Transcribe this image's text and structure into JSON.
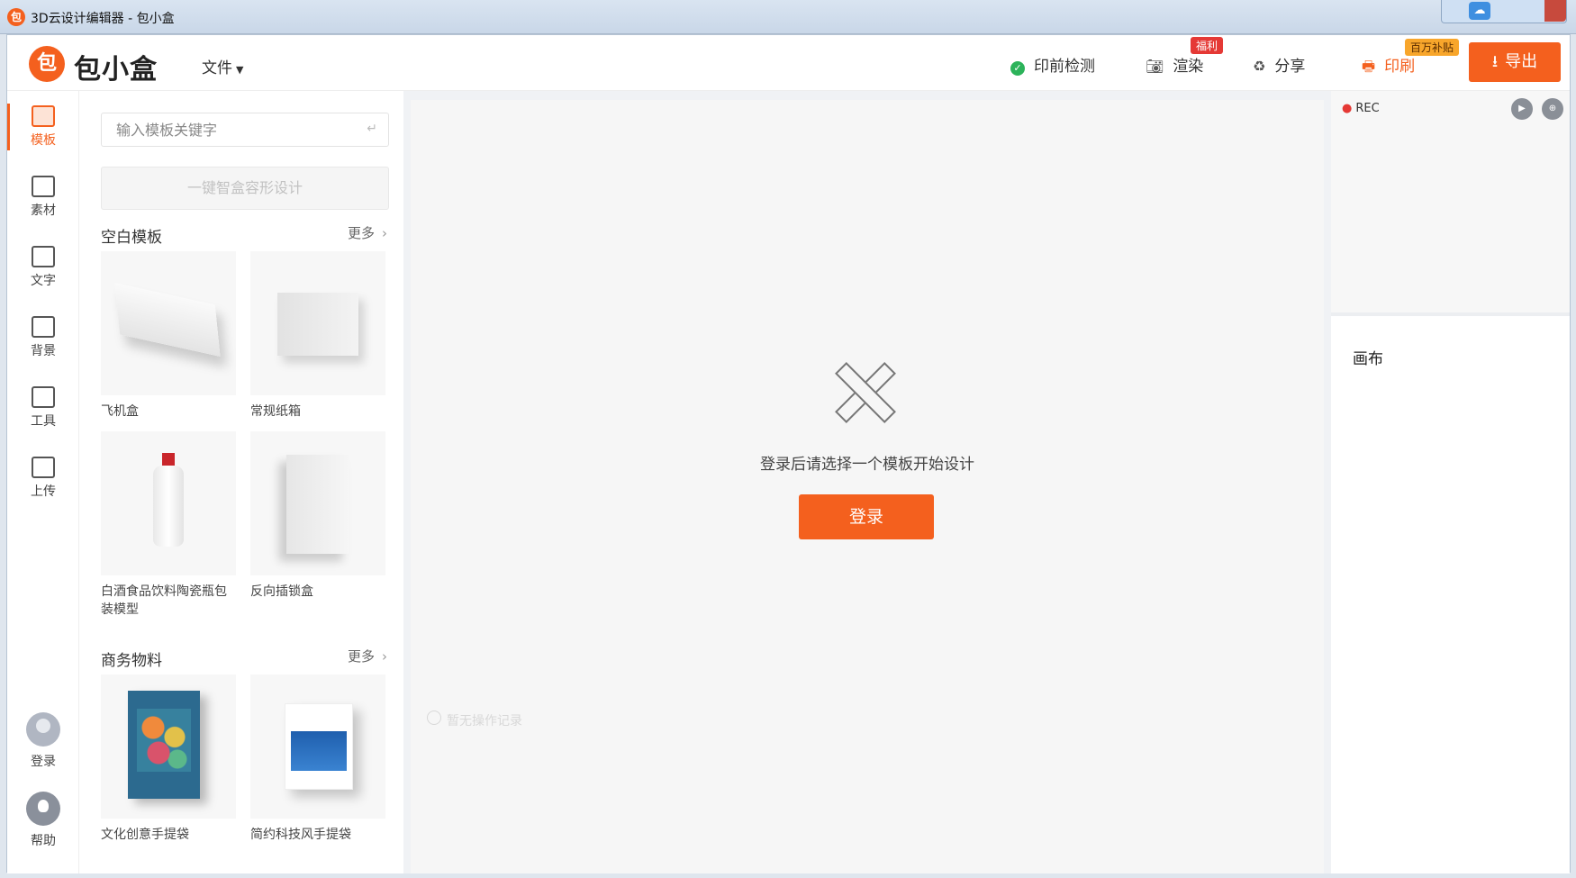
{
  "window": {
    "title": "3D云设计编辑器 - 包小盒"
  },
  "header": {
    "brand": "包小盒",
    "file_menu": "文件",
    "preflight": "印前检测",
    "render": "渲染",
    "render_badge": "福利",
    "share": "分享",
    "print": "印刷",
    "print_badge": "百万补贴",
    "export": "导出"
  },
  "sidebar": {
    "items": [
      {
        "label": "模板",
        "icon": "template-icon"
      },
      {
        "label": "素材",
        "icon": "image-icon"
      },
      {
        "label": "文字",
        "icon": "text-icon"
      },
      {
        "label": "背景",
        "icon": "background-icon"
      },
      {
        "label": "工具",
        "icon": "tool-icon"
      },
      {
        "label": "上传",
        "icon": "upload-icon"
      }
    ],
    "login": "登录",
    "help": "帮助"
  },
  "panel": {
    "search_placeholder": "输入模板关键字",
    "design_button": "一键智盒容形设计",
    "sections": [
      {
        "title": "空白模板",
        "more": "更多",
        "items": [
          "飞机盒",
          "常规纸箱",
          "白酒食品饮料陶瓷瓶包装模型",
          "反向插锁盒"
        ]
      },
      {
        "title": "商务物料",
        "more": "更多",
        "items": [
          "文化创意手提袋",
          "简约科技风手提袋"
        ]
      }
    ]
  },
  "canvas": {
    "empty_text": "登录后请选择一个模板开始设计",
    "login_button": "登录",
    "hint": "暂无操作记录"
  },
  "right_panel": {
    "rec": "REC",
    "canvas_label": "画布"
  },
  "colors": {
    "accent": "#f4601e",
    "success": "#2cb35a",
    "badge_red": "#e53935",
    "badge_orange": "#f8a62b"
  }
}
